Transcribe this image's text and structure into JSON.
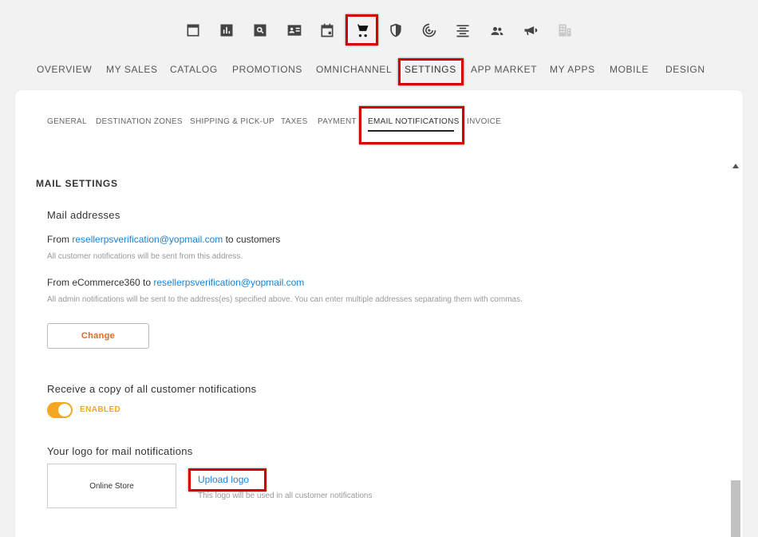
{
  "top_icons": [
    {
      "name": "window-icon"
    },
    {
      "name": "bar-chart-icon"
    },
    {
      "name": "search-icon"
    },
    {
      "name": "contact-card-icon"
    },
    {
      "name": "calendar-icon"
    },
    {
      "name": "shopping-cart-icon",
      "highlighted": true
    },
    {
      "name": "shield-icon"
    },
    {
      "name": "radar-icon"
    },
    {
      "name": "align-center-icon"
    },
    {
      "name": "people-icon"
    },
    {
      "name": "megaphone-icon"
    },
    {
      "name": "building-icon"
    }
  ],
  "main_nav": {
    "overview": "OVERVIEW",
    "my_sales": "MY SALES",
    "catalog": "CATALOG",
    "promotions": "PROMOTIONS",
    "omnichannel": "OMNICHANNEL",
    "settings": "SETTINGS",
    "app_market": "APP MARKET",
    "my_apps": "MY APPS",
    "mobile": "MOBILE",
    "design": "DESIGN",
    "active": "settings"
  },
  "sub_nav": {
    "general": "GENERAL",
    "destination_zones": "DESTINATION ZONES",
    "shipping_pickup": "SHIPPING & PICK-UP",
    "taxes": "TAXES",
    "payment": "PAYMENT",
    "email_notifications": "EMAIL NOTIFICATIONS",
    "invoice": "INVOICE",
    "active": "email_notifications"
  },
  "mail_settings": {
    "title": "MAIL SETTINGS",
    "addresses_label": "Mail addresses",
    "from_customers": {
      "prefix": "From ",
      "email": "resellerpsverification@yopmail.com",
      "suffix": " to customers",
      "hint": "All customer notifications will be sent from this address."
    },
    "from_admin": {
      "prefix": "From eCommerce360 to ",
      "email": "resellerpsverification@yopmail.com",
      "hint": "All admin notifications will be sent to the address(es) specified above. You can enter multiple addresses separating them with commas."
    },
    "change_button": "Change",
    "copy_label": "Receive a copy of all customer notifications",
    "copy_toggle_state": "ENABLED",
    "logo_label": "Your logo for mail notifications",
    "logo_placeholder": "Online Store",
    "upload_link": "Upload logo",
    "upload_hint": "This logo will be used in all customer notifications"
  },
  "colors": {
    "highlight": "#d40000",
    "link": "#1a82d6",
    "accent_orange": "#f5a623",
    "change_text": "#e8661c"
  }
}
